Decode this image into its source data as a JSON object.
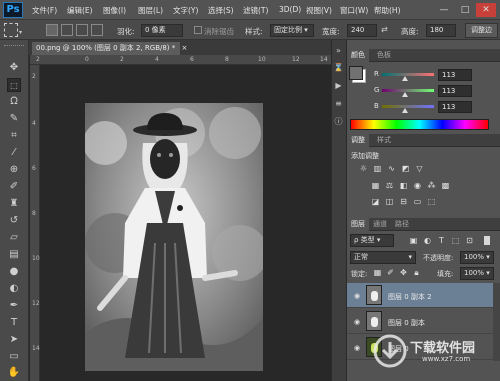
{
  "app": {
    "logo": "Ps"
  },
  "menu": [
    "文件(F)",
    "编辑(E)",
    "图像(I)",
    "图层(L)",
    "文字(Y)",
    "选择(S)",
    "滤镜(T)",
    "3D(D)",
    "视图(V)",
    "窗口(W)",
    "帮助(H)"
  ],
  "window_controls": {
    "minimize": "—",
    "maximize": "□",
    "close": "✕"
  },
  "options": {
    "feather_label": "羽化:",
    "feather_value": "0 像素",
    "antialias_label": "消除锯齿",
    "style_label": "样式:",
    "style_value": "固定比例",
    "width_label": "宽度:",
    "width_value": "240",
    "height_label": "高度:",
    "height_value": "180",
    "refine_edge": "调整边"
  },
  "document": {
    "tab_title": "00.png @ 100% (图层 0 副本 2, RGB/8) *",
    "tab_close": "×",
    "ruler_top": [
      "2",
      "0",
      "2",
      "4",
      "6",
      "8",
      "10",
      "12",
      "14"
    ],
    "ruler_left": [
      "2",
      "4",
      "6",
      "8",
      "10",
      "12",
      "14"
    ]
  },
  "color_panel": {
    "tabs": [
      "颜色",
      "色板"
    ],
    "r_label": "R",
    "g_label": "G",
    "b_label": "B",
    "r_value": "113",
    "g_value": "113",
    "b_value": "113",
    "r": 113,
    "g": 113,
    "b": 113,
    "foreground": "#717171",
    "background": "#ffffff"
  },
  "adjust_panel": {
    "tabs": [
      "调整",
      "样式"
    ],
    "heading": "添加调整"
  },
  "layers_panel": {
    "tabs": [
      "图层",
      "通道",
      "路径"
    ],
    "kind_filter": "ρ 类型",
    "blend_mode": "正常",
    "opacity_label": "不透明度:",
    "opacity_value": "100%",
    "lock_label": "锁定:",
    "fill_label": "填充:",
    "fill_value": "100%",
    "layers": [
      {
        "name": "图层 0 副本 2",
        "selected": true
      },
      {
        "name": "图层 0 副本",
        "selected": false
      },
      {
        "name": "图层 0",
        "selected": false
      }
    ]
  },
  "watermark": {
    "text": "下载软件园",
    "url": "www.xz7.com"
  },
  "icons": {
    "tools": [
      "move-icon",
      "marquee-icon",
      "lasso-icon",
      "quick-select-icon",
      "crop-icon",
      "eyedropper-icon",
      "healing-icon",
      "brush-icon",
      "stamp-icon",
      "history-brush-icon",
      "eraser-icon",
      "gradient-icon",
      "blur-icon",
      "dodge-icon",
      "pen-icon",
      "type-icon",
      "path-select-icon",
      "rectangle-icon",
      "hand-icon"
    ]
  }
}
